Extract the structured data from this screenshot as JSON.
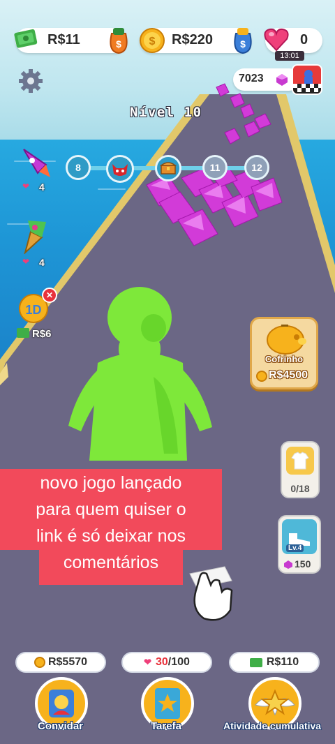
{
  "hud": {
    "cash": "R$11",
    "coins": "R$220",
    "hearts": "0",
    "heart_timer": "13:01",
    "gems": "7023"
  },
  "level": {
    "label": "Nível 10"
  },
  "progress": {
    "nodes": [
      "8",
      "11",
      "12"
    ]
  },
  "left_items": [
    {
      "name": "rocket",
      "count": "4"
    },
    {
      "name": "firework",
      "count": "4"
    },
    {
      "name": "offer",
      "price": "R$6"
    }
  ],
  "piggy": {
    "label": "Cofrinho",
    "value": "R$4500"
  },
  "skins": {
    "count": "0/18"
  },
  "upgrade": {
    "level": "Lv.4",
    "cost": "150"
  },
  "overlay": {
    "lines": [
      "novo jogo lançado",
      "para quem quiser o",
      "link é só deixar nos",
      "comentários"
    ]
  },
  "bottom": {
    "invite_reward": "R$5570",
    "task_current": "30",
    "task_total": "/100",
    "cumulative_reward": "R$110",
    "invite_label": "Convidar",
    "task_label": "Tarefa",
    "cumulative_label": "Atividade cumulativa"
  },
  "colors": {
    "road": "#6b6785",
    "gem": "#d23bd8",
    "runner": "#7ee83a",
    "overlay": "#f24a5b"
  }
}
